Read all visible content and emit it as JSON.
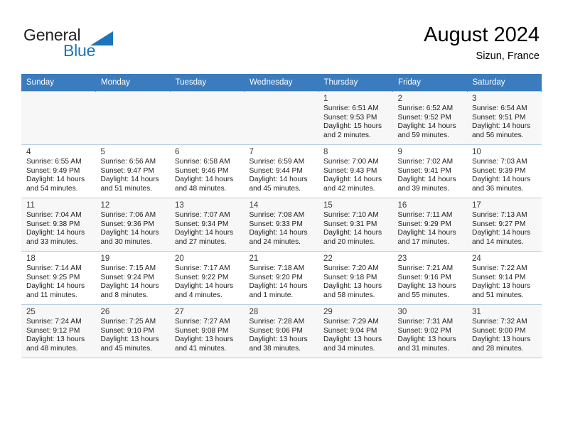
{
  "brand": {
    "name_part1": "General",
    "name_part2": "Blue",
    "logo_icon": "triangle-flag-icon",
    "color_primary": "#1b75bb",
    "color_text": "#231f20"
  },
  "header": {
    "title": "August 2024",
    "subtitle": "Sizun, France"
  },
  "calendar": {
    "accent_color": "#3a7cbe",
    "weekday_headers": [
      "Sunday",
      "Monday",
      "Tuesday",
      "Wednesday",
      "Thursday",
      "Friday",
      "Saturday"
    ],
    "weeks": [
      [
        {
          "day": "",
          "sunrise": "",
          "sunset": "",
          "daylight_line1": "",
          "daylight_line2": ""
        },
        {
          "day": "",
          "sunrise": "",
          "sunset": "",
          "daylight_line1": "",
          "daylight_line2": ""
        },
        {
          "day": "",
          "sunrise": "",
          "sunset": "",
          "daylight_line1": "",
          "daylight_line2": ""
        },
        {
          "day": "",
          "sunrise": "",
          "sunset": "",
          "daylight_line1": "",
          "daylight_line2": ""
        },
        {
          "day": "1",
          "sunrise": "Sunrise: 6:51 AM",
          "sunset": "Sunset: 9:53 PM",
          "daylight_line1": "Daylight: 15 hours",
          "daylight_line2": "and 2 minutes."
        },
        {
          "day": "2",
          "sunrise": "Sunrise: 6:52 AM",
          "sunset": "Sunset: 9:52 PM",
          "daylight_line1": "Daylight: 14 hours",
          "daylight_line2": "and 59 minutes."
        },
        {
          "day": "3",
          "sunrise": "Sunrise: 6:54 AM",
          "sunset": "Sunset: 9:51 PM",
          "daylight_line1": "Daylight: 14 hours",
          "daylight_line2": "and 56 minutes."
        }
      ],
      [
        {
          "day": "4",
          "sunrise": "Sunrise: 6:55 AM",
          "sunset": "Sunset: 9:49 PM",
          "daylight_line1": "Daylight: 14 hours",
          "daylight_line2": "and 54 minutes."
        },
        {
          "day": "5",
          "sunrise": "Sunrise: 6:56 AM",
          "sunset": "Sunset: 9:47 PM",
          "daylight_line1": "Daylight: 14 hours",
          "daylight_line2": "and 51 minutes."
        },
        {
          "day": "6",
          "sunrise": "Sunrise: 6:58 AM",
          "sunset": "Sunset: 9:46 PM",
          "daylight_line1": "Daylight: 14 hours",
          "daylight_line2": "and 48 minutes."
        },
        {
          "day": "7",
          "sunrise": "Sunrise: 6:59 AM",
          "sunset": "Sunset: 9:44 PM",
          "daylight_line1": "Daylight: 14 hours",
          "daylight_line2": "and 45 minutes."
        },
        {
          "day": "8",
          "sunrise": "Sunrise: 7:00 AM",
          "sunset": "Sunset: 9:43 PM",
          "daylight_line1": "Daylight: 14 hours",
          "daylight_line2": "and 42 minutes."
        },
        {
          "day": "9",
          "sunrise": "Sunrise: 7:02 AM",
          "sunset": "Sunset: 9:41 PM",
          "daylight_line1": "Daylight: 14 hours",
          "daylight_line2": "and 39 minutes."
        },
        {
          "day": "10",
          "sunrise": "Sunrise: 7:03 AM",
          "sunset": "Sunset: 9:39 PM",
          "daylight_line1": "Daylight: 14 hours",
          "daylight_line2": "and 36 minutes."
        }
      ],
      [
        {
          "day": "11",
          "sunrise": "Sunrise: 7:04 AM",
          "sunset": "Sunset: 9:38 PM",
          "daylight_line1": "Daylight: 14 hours",
          "daylight_line2": "and 33 minutes."
        },
        {
          "day": "12",
          "sunrise": "Sunrise: 7:06 AM",
          "sunset": "Sunset: 9:36 PM",
          "daylight_line1": "Daylight: 14 hours",
          "daylight_line2": "and 30 minutes."
        },
        {
          "day": "13",
          "sunrise": "Sunrise: 7:07 AM",
          "sunset": "Sunset: 9:34 PM",
          "daylight_line1": "Daylight: 14 hours",
          "daylight_line2": "and 27 minutes."
        },
        {
          "day": "14",
          "sunrise": "Sunrise: 7:08 AM",
          "sunset": "Sunset: 9:33 PM",
          "daylight_line1": "Daylight: 14 hours",
          "daylight_line2": "and 24 minutes."
        },
        {
          "day": "15",
          "sunrise": "Sunrise: 7:10 AM",
          "sunset": "Sunset: 9:31 PM",
          "daylight_line1": "Daylight: 14 hours",
          "daylight_line2": "and 20 minutes."
        },
        {
          "day": "16",
          "sunrise": "Sunrise: 7:11 AM",
          "sunset": "Sunset: 9:29 PM",
          "daylight_line1": "Daylight: 14 hours",
          "daylight_line2": "and 17 minutes."
        },
        {
          "day": "17",
          "sunrise": "Sunrise: 7:13 AM",
          "sunset": "Sunset: 9:27 PM",
          "daylight_line1": "Daylight: 14 hours",
          "daylight_line2": "and 14 minutes."
        }
      ],
      [
        {
          "day": "18",
          "sunrise": "Sunrise: 7:14 AM",
          "sunset": "Sunset: 9:25 PM",
          "daylight_line1": "Daylight: 14 hours",
          "daylight_line2": "and 11 minutes."
        },
        {
          "day": "19",
          "sunrise": "Sunrise: 7:15 AM",
          "sunset": "Sunset: 9:24 PM",
          "daylight_line1": "Daylight: 14 hours",
          "daylight_line2": "and 8 minutes."
        },
        {
          "day": "20",
          "sunrise": "Sunrise: 7:17 AM",
          "sunset": "Sunset: 9:22 PM",
          "daylight_line1": "Daylight: 14 hours",
          "daylight_line2": "and 4 minutes."
        },
        {
          "day": "21",
          "sunrise": "Sunrise: 7:18 AM",
          "sunset": "Sunset: 9:20 PM",
          "daylight_line1": "Daylight: 14 hours",
          "daylight_line2": "and 1 minute."
        },
        {
          "day": "22",
          "sunrise": "Sunrise: 7:20 AM",
          "sunset": "Sunset: 9:18 PM",
          "daylight_line1": "Daylight: 13 hours",
          "daylight_line2": "and 58 minutes."
        },
        {
          "day": "23",
          "sunrise": "Sunrise: 7:21 AM",
          "sunset": "Sunset: 9:16 PM",
          "daylight_line1": "Daylight: 13 hours",
          "daylight_line2": "and 55 minutes."
        },
        {
          "day": "24",
          "sunrise": "Sunrise: 7:22 AM",
          "sunset": "Sunset: 9:14 PM",
          "daylight_line1": "Daylight: 13 hours",
          "daylight_line2": "and 51 minutes."
        }
      ],
      [
        {
          "day": "25",
          "sunrise": "Sunrise: 7:24 AM",
          "sunset": "Sunset: 9:12 PM",
          "daylight_line1": "Daylight: 13 hours",
          "daylight_line2": "and 48 minutes."
        },
        {
          "day": "26",
          "sunrise": "Sunrise: 7:25 AM",
          "sunset": "Sunset: 9:10 PM",
          "daylight_line1": "Daylight: 13 hours",
          "daylight_line2": "and 45 minutes."
        },
        {
          "day": "27",
          "sunrise": "Sunrise: 7:27 AM",
          "sunset": "Sunset: 9:08 PM",
          "daylight_line1": "Daylight: 13 hours",
          "daylight_line2": "and 41 minutes."
        },
        {
          "day": "28",
          "sunrise": "Sunrise: 7:28 AM",
          "sunset": "Sunset: 9:06 PM",
          "daylight_line1": "Daylight: 13 hours",
          "daylight_line2": "and 38 minutes."
        },
        {
          "day": "29",
          "sunrise": "Sunrise: 7:29 AM",
          "sunset": "Sunset: 9:04 PM",
          "daylight_line1": "Daylight: 13 hours",
          "daylight_line2": "and 34 minutes."
        },
        {
          "day": "30",
          "sunrise": "Sunrise: 7:31 AM",
          "sunset": "Sunset: 9:02 PM",
          "daylight_line1": "Daylight: 13 hours",
          "daylight_line2": "and 31 minutes."
        },
        {
          "day": "31",
          "sunrise": "Sunrise: 7:32 AM",
          "sunset": "Sunset: 9:00 PM",
          "daylight_line1": "Daylight: 13 hours",
          "daylight_line2": "and 28 minutes."
        }
      ]
    ]
  }
}
